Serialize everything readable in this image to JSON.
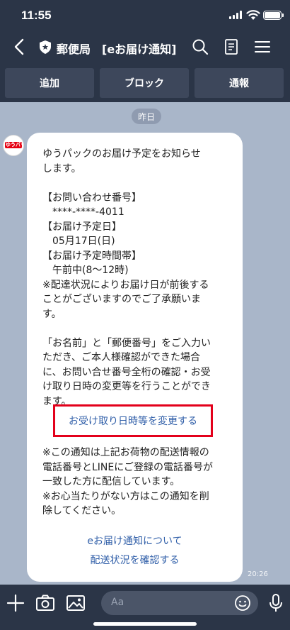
{
  "status_bar": {
    "time": "11:55"
  },
  "header": {
    "title": "郵便局　[eお届け通知]",
    "icons": [
      "back-chevron-icon",
      "shield-icon",
      "search-icon",
      "notes-icon",
      "menu-icon"
    ]
  },
  "actions": {
    "add": "追加",
    "block": "ブロック",
    "report": "通報"
  },
  "date_label": "昨日",
  "avatar_text": "ゆうパック",
  "message": {
    "lines": [
      "ゆうパックのお届け予定をお知らせ",
      "します。",
      "",
      "【お問い合わせ番号】",
      "　****-****-4011",
      "【お届け予定日】",
      "　05月17日(日)",
      "【お届け予定時間帯】",
      "　午前中(8～12時)",
      "※配達状況によりお届け日が前後する",
      "ことがございますのでご了承願いま",
      "す。",
      "",
      "「お名前」と「郵便番号」をご入力い",
      "ただき、ご本人様確認ができた場合",
      "に、お問い合せ番号全桁の確認・お受",
      "け取り日時の変更等を行うことができ",
      "ます。"
    ],
    "change_link": "お受け取り日時等を変更する",
    "note_lines": [
      "※この通知は上記お荷物の配送情報の",
      "電話番号とLINEにご登録の電話番号が",
      "一致した方に配信しています。",
      "※お心当たりがない方はこの通知を削",
      "除してください。"
    ],
    "link_about": "eお届け通知について",
    "link_status": "配送状況を確認する",
    "time": "20:26"
  },
  "input_bar": {
    "placeholder": "Aa",
    "icons": [
      "plus-icon",
      "camera-icon",
      "image-icon",
      "emoji-icon",
      "microphone-icon"
    ]
  },
  "colors": {
    "bar": "#2b3547",
    "button": "#3d475b",
    "background": "#a9b6c9",
    "link": "#2f5ea8",
    "highlight": "#e3001b"
  }
}
